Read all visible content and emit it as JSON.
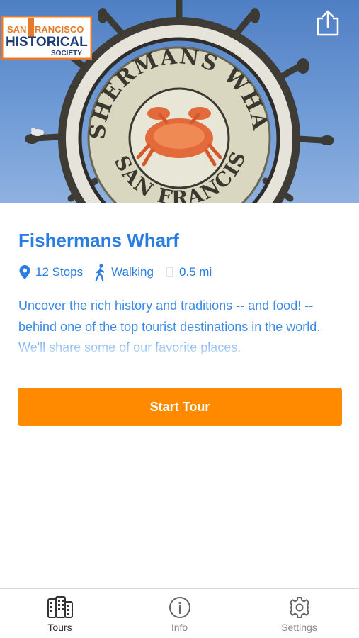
{
  "hero": {
    "logo_lines": [
      "SAN FRANCISCO",
      "HISTORICAL",
      "SOCIETY"
    ],
    "sign_text_top": "FISHERMANS WHARF",
    "sign_text_bottom": "OF SAN FRANCISCO",
    "share_icon": "share-icon"
  },
  "tour": {
    "title": "Fishermans Wharf",
    "stops": "12 Stops",
    "mode": "Walking",
    "distance": "0.5 mi",
    "description": "Uncover the rich history and traditions -- and food! -- behind one of the top tourist destinations in the world. We'll share some of our favorite places."
  },
  "actions": {
    "start_label": "Start Tour"
  },
  "tabs": [
    {
      "label": "Tours",
      "icon": "buildings-icon",
      "active": true
    },
    {
      "label": "Info",
      "icon": "info-icon",
      "active": false
    },
    {
      "label": "Settings",
      "icon": "gear-icon",
      "active": false
    }
  ],
  "colors": {
    "accent": "#2a7de1",
    "button": "#ff8a00"
  }
}
